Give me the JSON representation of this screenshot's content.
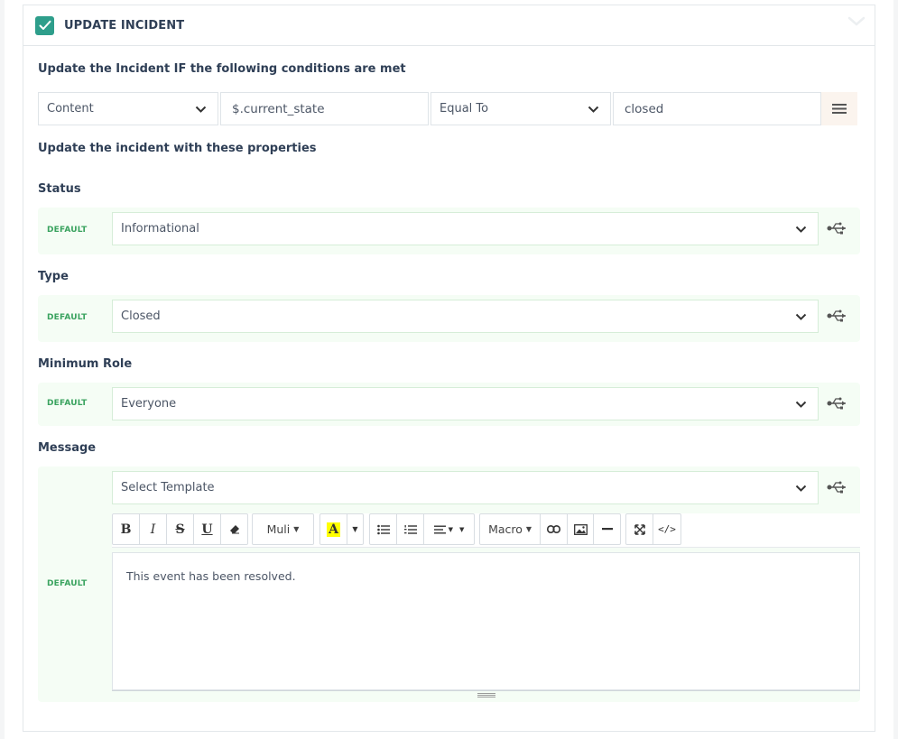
{
  "header": {
    "title": "UPDATE INCIDENT"
  },
  "conditions": {
    "heading": "Update the Incident IF the following conditions are met",
    "field": "Content",
    "path": "$.current_state",
    "operator": "Equal To",
    "value": "closed"
  },
  "properties_heading": "Update the incident with these properties",
  "default_tag": "DEFAULT",
  "status": {
    "label": "Status",
    "value": "Informational"
  },
  "type": {
    "label": "Type",
    "value": "Closed"
  },
  "min_role": {
    "label": "Minimum Role",
    "value": "Everyone"
  },
  "message": {
    "label": "Message",
    "template": "Select Template",
    "body": "This event has been resolved."
  },
  "toolbar": {
    "bold": "B",
    "italic": "I",
    "strike": "S",
    "underline": "U",
    "font": "Muli",
    "highlight": "A",
    "macro": "Macro",
    "code": "</>"
  },
  "colors": {
    "accent": "#2e9e8b",
    "default_tag": "#3aa35f",
    "row_bg": "#f5fdf5",
    "text": "#2f3f56"
  }
}
